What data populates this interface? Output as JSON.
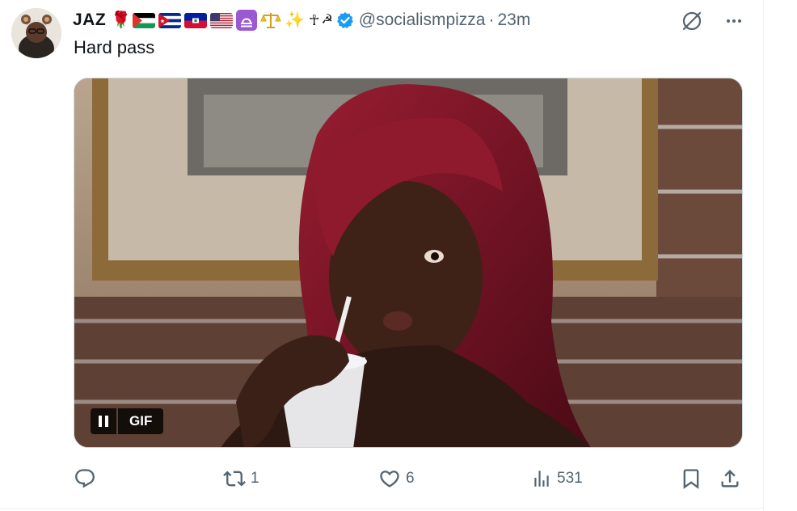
{
  "tweet": {
    "display_name": "JAZ",
    "name_emojis": [
      "🌹",
      "✨",
      "☥",
      "☭"
    ],
    "handle": "@socialismpizza",
    "separator": "·",
    "time": "23m",
    "text": "Hard pass"
  },
  "media": {
    "badge_label": "GIF"
  },
  "actions": {
    "reply_count": "",
    "repost_count": "1",
    "like_count": "6",
    "views_count": "531"
  },
  "icons": {
    "grok": "grok-icon",
    "more": "more-icon",
    "reply": "reply-icon",
    "repost": "repost-icon",
    "like": "heart-icon",
    "views": "views-icon",
    "bookmark": "bookmark-icon",
    "share": "share-icon",
    "pause": "pause-icon",
    "verified": "verified-badge-icon"
  },
  "colors": {
    "verified_blue": "#1d9bf0",
    "secondary_text": "#536471",
    "primary_text": "#0f1419"
  }
}
